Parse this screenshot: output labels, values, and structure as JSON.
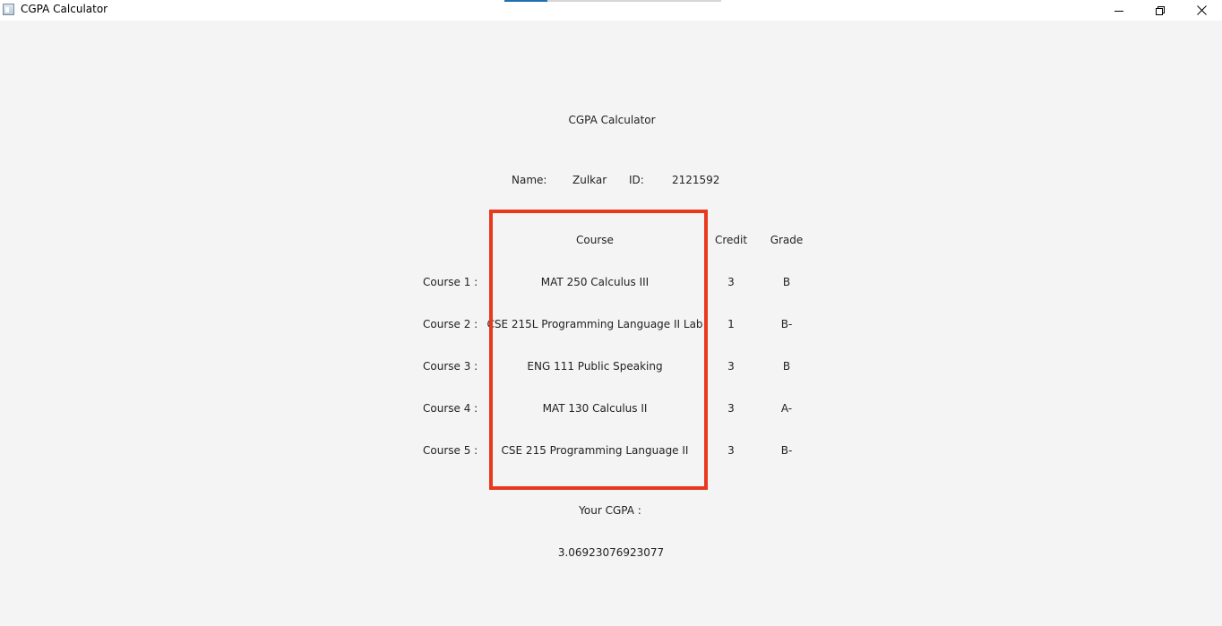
{
  "window": {
    "title": "CGPA Calculator",
    "icon": "app-window-icon",
    "progress": 0.2
  },
  "app": {
    "heading": "CGPA Calculator",
    "name_label": "Name:",
    "name_value": "Zulkar",
    "id_label": "ID:",
    "id_value": "2121592"
  },
  "table": {
    "headers": {
      "course": "Course",
      "credit": "Credit",
      "grade": "Grade"
    },
    "rows": [
      {
        "label": "Course 1 :",
        "course": "MAT 250 Calculus III",
        "credit": "3",
        "grade": "B"
      },
      {
        "label": "Course 2 :",
        "course": "CSE 215L Programming Language II Lab",
        "credit": "1",
        "grade": "B-"
      },
      {
        "label": "Course 3 :",
        "course": "ENG 111 Public Speaking",
        "credit": "3",
        "grade": "B"
      },
      {
        "label": "Course 4 :",
        "course": "MAT 130 Calculus II",
        "credit": "3",
        "grade": "A-"
      },
      {
        "label": "Course 5 :",
        "course": "CSE 215 Programming Language II",
        "credit": "3",
        "grade": "B-"
      }
    ]
  },
  "result": {
    "label": "Your CGPA :",
    "value": "3.06923076923077"
  },
  "colors": {
    "background": "#f4f4f4",
    "highlight": "#e8391f",
    "progress": "#1f6fb2"
  }
}
